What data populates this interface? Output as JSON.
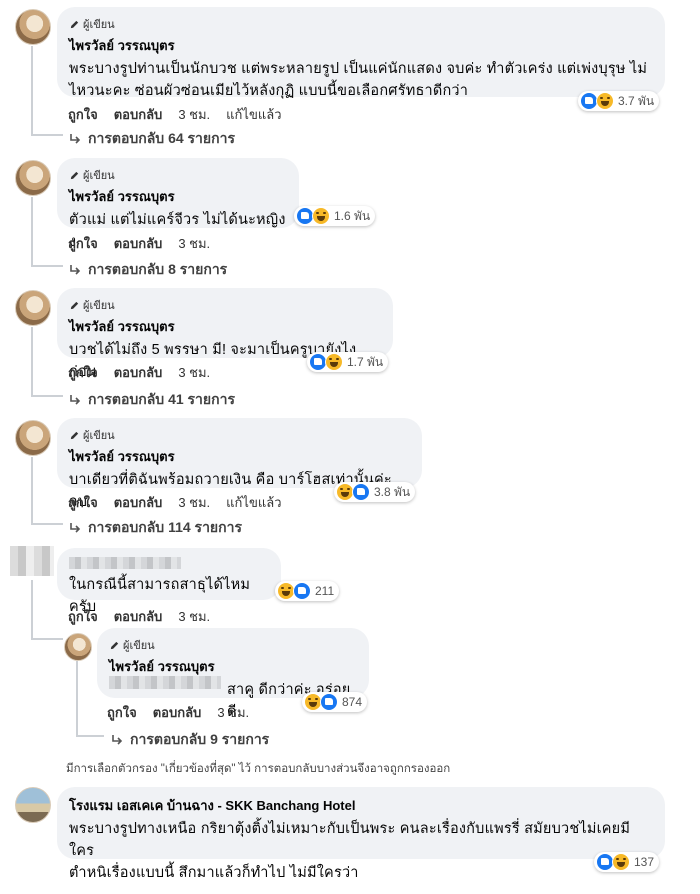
{
  "author_tag": "ผู้เขียน",
  "author_name": "ไพรวัลย์ วรรณบุตร",
  "comments": [
    {
      "text_line1": "พระบางรูปท่านเป็นนักบวช แต่พระหลายรูป เป็นแค่นักแสดง จบค่ะ ทำตัวเคร่ง แต่เพ่งบุรุษ ไม่",
      "text_line2": "ไหวนะคะ ซ่อนผัวซ่อนเมียไว้หลังกุฏิ แบบนี้ขอเลือกศรัทธาดีกว่า",
      "like": "ถูกใจ",
      "reply": "ตอบกลับ",
      "time": "3 ชม.",
      "edited": "แก้ไขแล้ว",
      "reactions": "3.7 พัน",
      "replies": "การตอบกลับ 64 รายการ"
    },
    {
      "text": "ตัวแม่ แต่ไม่แคร์จีวร ไม่ได้นะหญิงง",
      "like": "ถูกใจ",
      "reply": "ตอบกลับ",
      "time": "3 ชม.",
      "reactions": "1.6 พัน",
      "replies": "การตอบกลับ 8 รายการ"
    },
    {
      "text": "บวชได้ไม่ถึง 5 พรรษา มี! จะมาเป็นครูบายังไงก่อน",
      "like": "ถูกใจ",
      "reply": "ตอบกลับ",
      "time": "3 ชม.",
      "reactions": "1.7 พัน",
      "replies": "การตอบกลับ 41 รายการ"
    },
    {
      "text": "บาเดียวที่ติฉันพร้อมถวายเงิน คือ บาร์โฮสเท่านั้นค่ะ จบ",
      "like": "ถูกใจ",
      "reply": "ตอบกลับ",
      "time": "3 ชม.",
      "edited": "แก้ไขแล้ว",
      "reactions": "3.8 พัน",
      "replies": "การตอบกลับ 114 รายการ"
    },
    {
      "text": "ในกรณีนี้สามารถสาธุได้ไหมครับ",
      "like": "ถูกใจ",
      "reply": "ตอบกลับ",
      "time": "3 ชม.",
      "reactions": "211"
    }
  ],
  "nested_reply": {
    "text": "สาคู ดีกว่าค่ะ อร่อยดี",
    "like": "ถูกใจ",
    "reply": "ตอบกลับ",
    "time": "3 ชม.",
    "reactions": "874",
    "replies": "การตอบกลับ 9 รายการ"
  },
  "filter_note": "มีการเลือกตัวกรอง \"เกี่ยวข้องที่สุด\" ไว้ การตอบกลับบางส่วนจึงอาจถูกกรองออก",
  "hotel_comment": {
    "name": "โรงแรม เอสเคเค บ้านฉาง - SKK Banchang Hotel",
    "text_line1": "พระบางรูปทางเหนือ กริยาตุ้งติ้งไม่เหมาะกับเป็นพระ คนละเรื่องกับแพรรี่ สมัยบวชไม่เคยมีใคร",
    "text_line2": "ตำหนิเรื่องแบบนี้ สึกมาแล้วก็ทำไป ไม่มีใครว่า",
    "reactions": "137"
  },
  "icons": {
    "pencil": "pencil-icon",
    "reply_arrow": "reply-arrow-icon",
    "like": "like-reaction-icon",
    "haha": "haha-reaction-icon"
  },
  "colors": {
    "bubble": "#f0f2f5",
    "like_blue": "#1877f2",
    "haha_yellow": "#f7b928"
  }
}
